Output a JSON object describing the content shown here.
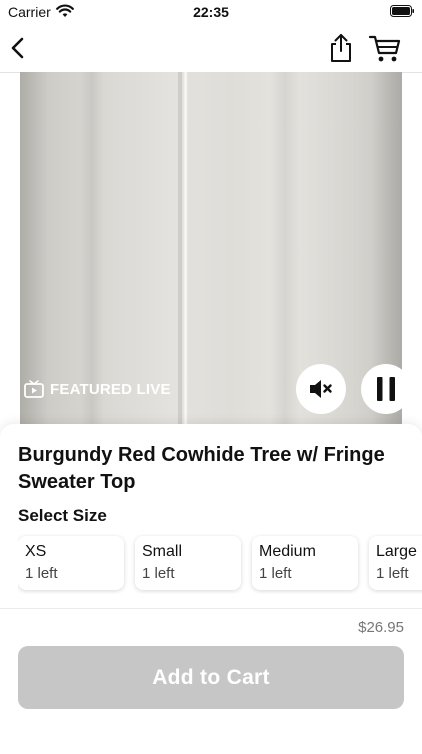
{
  "status_bar": {
    "carrier": "Carrier",
    "time": "22:35"
  },
  "nav": {
    "icons": [
      "chevron-left-icon",
      "share-icon",
      "cart-icon"
    ]
  },
  "video": {
    "badge": "FEATURED LIVE",
    "controls": [
      "mute-icon",
      "pause-icon"
    ]
  },
  "product": {
    "title": "Burgundy Red Cowhide Tree w/ Fringe Sweater Top",
    "size_heading": "Select Size",
    "sizes": [
      {
        "name": "XS",
        "stock": "1 left"
      },
      {
        "name": "Small",
        "stock": "1 left"
      },
      {
        "name": "Medium",
        "stock": "1 left"
      },
      {
        "name": "Large",
        "stock": "1 left"
      }
    ],
    "price": "$26.95",
    "add_to_cart_label": "Add to Cart"
  },
  "colors": {
    "button_disabled": "#c6c6c6",
    "badge_text": "#ffffff"
  }
}
